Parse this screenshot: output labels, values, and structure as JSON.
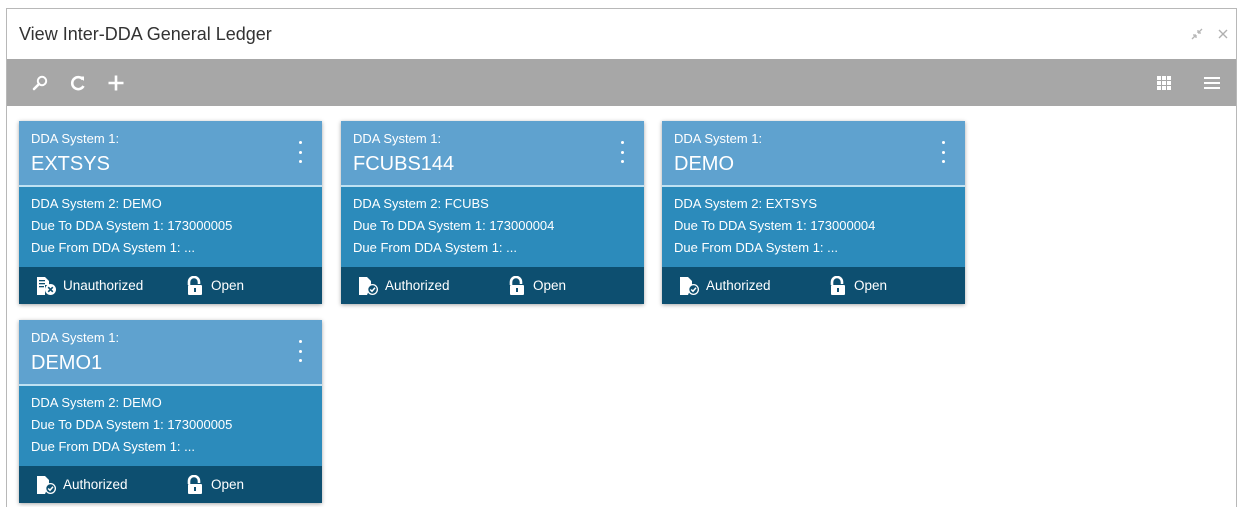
{
  "window": {
    "title": "View Inter-DDA General Ledger"
  },
  "toolbar": {
    "left_icons": [
      "search-icon",
      "refresh-icon",
      "add-icon"
    ],
    "right_icons": [
      "grid-view-icon",
      "list-view-icon"
    ]
  },
  "colors": {
    "toolbar": "#a7a7a7",
    "card_header": "#5fa2cf",
    "card_body": "#2c8bbb",
    "card_footer": "#0d4f70"
  },
  "cards": [
    {
      "sys1_label": "DDA System 1:",
      "sys1_value": "EXTSYS",
      "sys2": "DDA System 2:  DEMO",
      "due_to": "Due To DDA System 1:  173000005",
      "due_from": "Due From DDA System 1: ...",
      "auth_status": "Unauthorized",
      "auth_icon": "unauthorized-doc-icon",
      "record_status": "Open",
      "record_icon": "unlock-icon"
    },
    {
      "sys1_label": "DDA System 1:",
      "sys1_value": "FCUBS144",
      "sys2": "DDA System 2:  FCUBS",
      "due_to": "Due To DDA System 1:  173000004",
      "due_from": "Due From DDA System 1: ...",
      "auth_status": "Authorized",
      "auth_icon": "authorized-doc-icon",
      "record_status": "Open",
      "record_icon": "unlock-icon"
    },
    {
      "sys1_label": "DDA System 1:",
      "sys1_value": "DEMO",
      "sys2": "DDA System 2:  EXTSYS",
      "due_to": "Due To DDA System 1:  173000004",
      "due_from": "Due From DDA System 1: ...",
      "auth_status": "Authorized",
      "auth_icon": "authorized-doc-icon",
      "record_status": "Open",
      "record_icon": "unlock-icon"
    },
    {
      "sys1_label": "DDA System 1:",
      "sys1_value": "DEMO1",
      "sys2": "DDA System 2:  DEMO",
      "due_to": "Due To DDA System 1:  173000005",
      "due_from": "Due From DDA System 1: ...",
      "auth_status": "Authorized",
      "auth_icon": "authorized-doc-icon",
      "record_status": "Open",
      "record_icon": "unlock-icon"
    }
  ]
}
